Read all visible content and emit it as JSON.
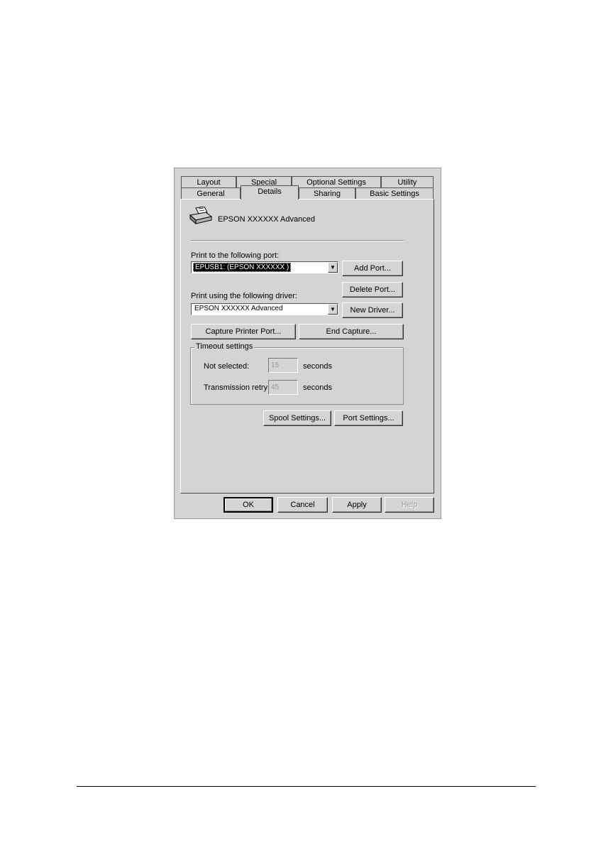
{
  "tabs_row1": [
    "Layout",
    "Special",
    "Optional Settings",
    "Utility"
  ],
  "tabs_row2": [
    "General",
    "Details",
    "Sharing",
    "Basic Settings"
  ],
  "printer": {
    "name": "EPSON  XXXXXX Advanced",
    "icon": "printer-icon"
  },
  "port": {
    "label": "Print to the following port:",
    "value": "EPUSB1:  (EPSON XXXXXX  )",
    "add_button": "Add Port...",
    "delete_button": "Delete Port..."
  },
  "driver": {
    "label": "Print using the following driver:",
    "value": "EPSON  XXXXXX  Advanced",
    "new_button": "New Driver..."
  },
  "capture": {
    "capture_button": "Capture Printer Port...",
    "end_button": "End Capture..."
  },
  "timeout": {
    "title": "Timeout settings",
    "not_selected_label": "Not selected:",
    "not_selected_value": "15",
    "transmission_label": "Transmission retry:",
    "transmission_value": "45",
    "unit": "seconds"
  },
  "spool": {
    "spool_button": "Spool Settings...",
    "port_settings_button": "Port Settings..."
  },
  "footer": {
    "ok": "OK",
    "cancel": "Cancel",
    "apply": "Apply",
    "help": "Help"
  }
}
